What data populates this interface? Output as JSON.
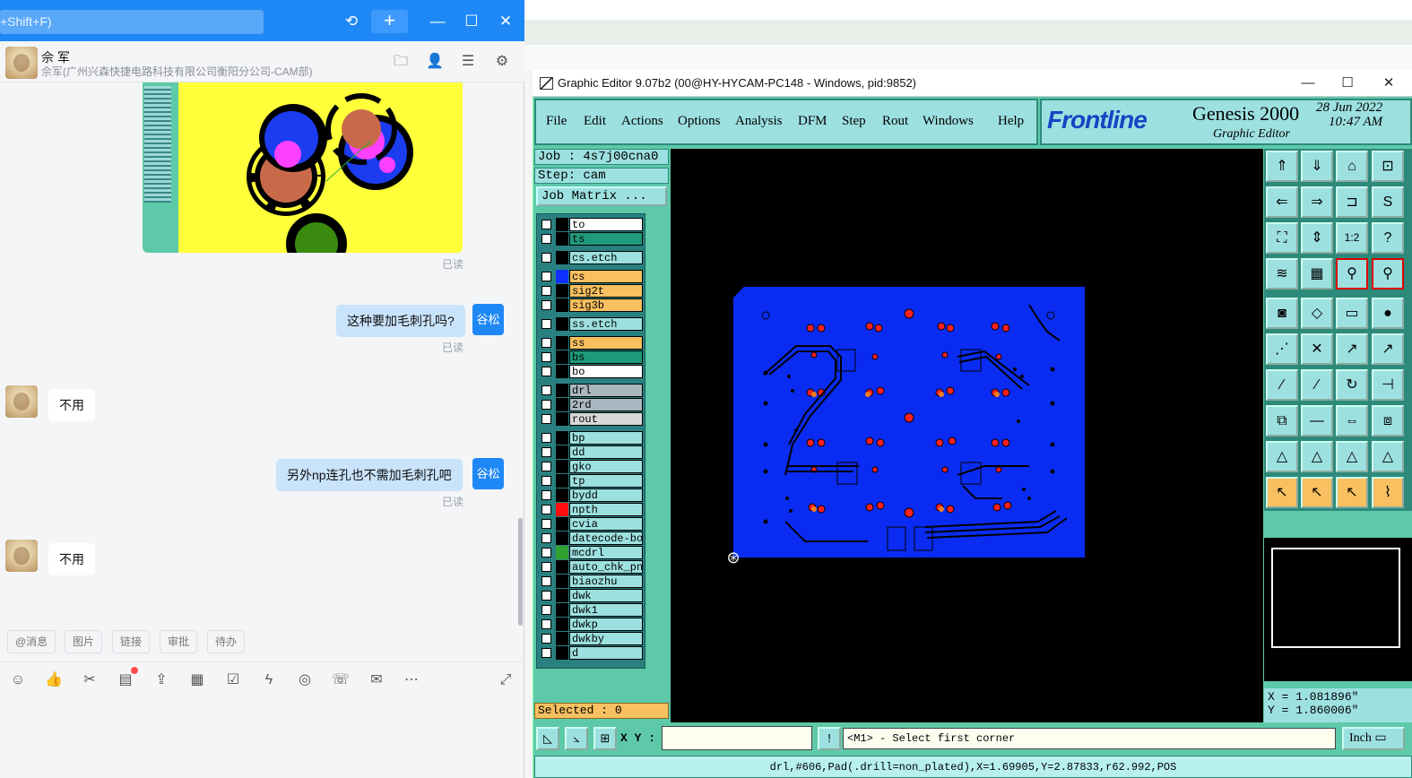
{
  "chat": {
    "search_hint": "+Shift+F)",
    "contact_name": "佘 军",
    "contact_sub": "佘军(广州兴森快捷电路科技有限公司衡阳分公司-CAM部)",
    "self_avatar": "谷松",
    "read_label": "已读",
    "messages": [
      {
        "side": "right",
        "text": "这种要加毛刺孔吗?"
      },
      {
        "side": "left",
        "text": "不用"
      },
      {
        "side": "right",
        "text": "另外np连孔也不需加毛刺孔吧"
      },
      {
        "side": "left",
        "text": "不用"
      }
    ],
    "quick_actions": [
      "@消息",
      "图片",
      "链接",
      "审批",
      "待办"
    ],
    "accent": "#1e88f6",
    "bubble_color": "#c9e3fb"
  },
  "genesis": {
    "window_title": "Graphic Editor 9.07b2 (00@HY-HYCAM-PC148 - Windows, pid:9852)",
    "menu": [
      "File",
      "Edit",
      "Actions",
      "Options",
      "Analysis",
      "DFM",
      "Step",
      "Rout",
      "Windows",
      "Help"
    ],
    "logo_brand": "Frontline",
    "logo_product": "Genesis 2000",
    "logo_subtitle": "Graphic Editor",
    "date": "28 Jun 2022",
    "time": "10:47 AM",
    "job": "Job : 4s7j00cna0",
    "step": "Step: cam",
    "job_matrix": "Job Matrix ...",
    "layers": [
      {
        "name": "to",
        "bg": "#ffffff",
        "clr": "#000000"
      },
      {
        "name": "ts",
        "bg": "#1f9a7a",
        "clr": "#000000"
      },
      {
        "name": "cs.etch",
        "bg": "#9de0e0",
        "clr": "#000000"
      },
      {
        "name": "cs",
        "bg": "#f8c060",
        "clr": "#1030ff"
      },
      {
        "name": "sig2t",
        "bg": "#f8c060",
        "clr": "#000000"
      },
      {
        "name": "sig3b",
        "bg": "#f8c060",
        "clr": "#000000"
      },
      {
        "name": "ss.etch",
        "bg": "#9de0e0",
        "clr": "#000000"
      },
      {
        "name": "ss",
        "bg": "#f8c060",
        "clr": "#000000"
      },
      {
        "name": "bs",
        "bg": "#1f9a7a",
        "clr": "#000000"
      },
      {
        "name": "bo",
        "bg": "#ffffff",
        "clr": "#000000"
      },
      {
        "name": "drl",
        "bg": "#a9b8c0",
        "clr": "#000000"
      },
      {
        "name": "2rd",
        "bg": "#a9b8c0",
        "clr": "#000000"
      },
      {
        "name": "rout",
        "bg": "#d8d8d8",
        "clr": "#000000"
      },
      {
        "name": "bp",
        "bg": "#9de0e0",
        "clr": "#000000"
      },
      {
        "name": "dd",
        "bg": "#9de0e0",
        "clr": "#000000"
      },
      {
        "name": "gko",
        "bg": "#9de0e0",
        "clr": "#000000"
      },
      {
        "name": "tp",
        "bg": "#9de0e0",
        "clr": "#000000"
      },
      {
        "name": "bydd",
        "bg": "#9de0e0",
        "clr": "#000000"
      },
      {
        "name": "npth",
        "bg": "#9de0e0",
        "clr": "#ff1010"
      },
      {
        "name": "cvia",
        "bg": "#9de0e0",
        "clr": "#000000"
      },
      {
        "name": "datecode-bo",
        "bg": "#9de0e0",
        "clr": "#000000"
      },
      {
        "name": "mcdrl",
        "bg": "#9de0e0",
        "clr": "#30a030"
      },
      {
        "name": "auto_chk_pn",
        "bg": "#9de0e0",
        "clr": "#000000"
      },
      {
        "name": "biaozhu",
        "bg": "#9de0e0",
        "clr": "#000000"
      },
      {
        "name": "dwk",
        "bg": "#9de0e0",
        "clr": "#000000"
      },
      {
        "name": "dwk1",
        "bg": "#9de0e0",
        "clr": "#000000"
      },
      {
        "name": "dwkp",
        "bg": "#9de0e0",
        "clr": "#000000"
      },
      {
        "name": "dwkby",
        "bg": "#9de0e0",
        "clr": "#000000"
      },
      {
        "name": "d",
        "bg": "#9de0e0",
        "clr": "#000000"
      }
    ],
    "selected": "Selected : 0",
    "coord_x": "X = 1.081896\"",
    "coord_y": "Y = 1.860006\"",
    "xy_label": "X Y :",
    "xy_value": "",
    "prompt": "<M1> - Select first corner",
    "unit": "Inch",
    "status": "drl,#606,Pad(.drill=non_plated),X=1.69905,Y=2.87833,r62.992,POS",
    "ratio_label": "1:2",
    "board_color": "#0a2cf2",
    "panel_color": "#5ec9a8"
  }
}
